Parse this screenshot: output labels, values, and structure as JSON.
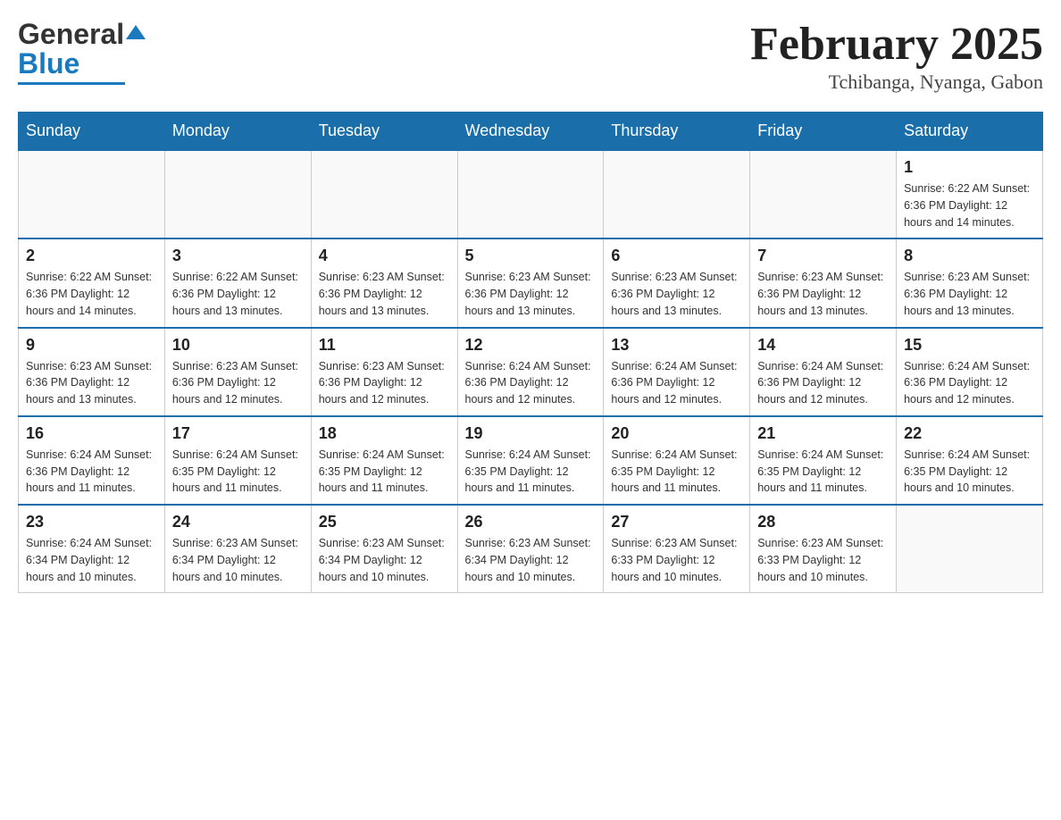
{
  "header": {
    "logo_general": "General",
    "logo_blue": "Blue",
    "title": "February 2025",
    "subtitle": "Tchibanga, Nyanga, Gabon"
  },
  "weekdays": [
    "Sunday",
    "Monday",
    "Tuesday",
    "Wednesday",
    "Thursday",
    "Friday",
    "Saturday"
  ],
  "weeks": [
    [
      {
        "day": "",
        "info": ""
      },
      {
        "day": "",
        "info": ""
      },
      {
        "day": "",
        "info": ""
      },
      {
        "day": "",
        "info": ""
      },
      {
        "day": "",
        "info": ""
      },
      {
        "day": "",
        "info": ""
      },
      {
        "day": "1",
        "info": "Sunrise: 6:22 AM\nSunset: 6:36 PM\nDaylight: 12 hours\nand 14 minutes."
      }
    ],
    [
      {
        "day": "2",
        "info": "Sunrise: 6:22 AM\nSunset: 6:36 PM\nDaylight: 12 hours\nand 14 minutes."
      },
      {
        "day": "3",
        "info": "Sunrise: 6:22 AM\nSunset: 6:36 PM\nDaylight: 12 hours\nand 13 minutes."
      },
      {
        "day": "4",
        "info": "Sunrise: 6:23 AM\nSunset: 6:36 PM\nDaylight: 12 hours\nand 13 minutes."
      },
      {
        "day": "5",
        "info": "Sunrise: 6:23 AM\nSunset: 6:36 PM\nDaylight: 12 hours\nand 13 minutes."
      },
      {
        "day": "6",
        "info": "Sunrise: 6:23 AM\nSunset: 6:36 PM\nDaylight: 12 hours\nand 13 minutes."
      },
      {
        "day": "7",
        "info": "Sunrise: 6:23 AM\nSunset: 6:36 PM\nDaylight: 12 hours\nand 13 minutes."
      },
      {
        "day": "8",
        "info": "Sunrise: 6:23 AM\nSunset: 6:36 PM\nDaylight: 12 hours\nand 13 minutes."
      }
    ],
    [
      {
        "day": "9",
        "info": "Sunrise: 6:23 AM\nSunset: 6:36 PM\nDaylight: 12 hours\nand 13 minutes."
      },
      {
        "day": "10",
        "info": "Sunrise: 6:23 AM\nSunset: 6:36 PM\nDaylight: 12 hours\nand 12 minutes."
      },
      {
        "day": "11",
        "info": "Sunrise: 6:23 AM\nSunset: 6:36 PM\nDaylight: 12 hours\nand 12 minutes."
      },
      {
        "day": "12",
        "info": "Sunrise: 6:24 AM\nSunset: 6:36 PM\nDaylight: 12 hours\nand 12 minutes."
      },
      {
        "day": "13",
        "info": "Sunrise: 6:24 AM\nSunset: 6:36 PM\nDaylight: 12 hours\nand 12 minutes."
      },
      {
        "day": "14",
        "info": "Sunrise: 6:24 AM\nSunset: 6:36 PM\nDaylight: 12 hours\nand 12 minutes."
      },
      {
        "day": "15",
        "info": "Sunrise: 6:24 AM\nSunset: 6:36 PM\nDaylight: 12 hours\nand 12 minutes."
      }
    ],
    [
      {
        "day": "16",
        "info": "Sunrise: 6:24 AM\nSunset: 6:36 PM\nDaylight: 12 hours\nand 11 minutes."
      },
      {
        "day": "17",
        "info": "Sunrise: 6:24 AM\nSunset: 6:35 PM\nDaylight: 12 hours\nand 11 minutes."
      },
      {
        "day": "18",
        "info": "Sunrise: 6:24 AM\nSunset: 6:35 PM\nDaylight: 12 hours\nand 11 minutes."
      },
      {
        "day": "19",
        "info": "Sunrise: 6:24 AM\nSunset: 6:35 PM\nDaylight: 12 hours\nand 11 minutes."
      },
      {
        "day": "20",
        "info": "Sunrise: 6:24 AM\nSunset: 6:35 PM\nDaylight: 12 hours\nand 11 minutes."
      },
      {
        "day": "21",
        "info": "Sunrise: 6:24 AM\nSunset: 6:35 PM\nDaylight: 12 hours\nand 11 minutes."
      },
      {
        "day": "22",
        "info": "Sunrise: 6:24 AM\nSunset: 6:35 PM\nDaylight: 12 hours\nand 10 minutes."
      }
    ],
    [
      {
        "day": "23",
        "info": "Sunrise: 6:24 AM\nSunset: 6:34 PM\nDaylight: 12 hours\nand 10 minutes."
      },
      {
        "day": "24",
        "info": "Sunrise: 6:23 AM\nSunset: 6:34 PM\nDaylight: 12 hours\nand 10 minutes."
      },
      {
        "day": "25",
        "info": "Sunrise: 6:23 AM\nSunset: 6:34 PM\nDaylight: 12 hours\nand 10 minutes."
      },
      {
        "day": "26",
        "info": "Sunrise: 6:23 AM\nSunset: 6:34 PM\nDaylight: 12 hours\nand 10 minutes."
      },
      {
        "day": "27",
        "info": "Sunrise: 6:23 AM\nSunset: 6:33 PM\nDaylight: 12 hours\nand 10 minutes."
      },
      {
        "day": "28",
        "info": "Sunrise: 6:23 AM\nSunset: 6:33 PM\nDaylight: 12 hours\nand 10 minutes."
      },
      {
        "day": "",
        "info": ""
      }
    ]
  ]
}
